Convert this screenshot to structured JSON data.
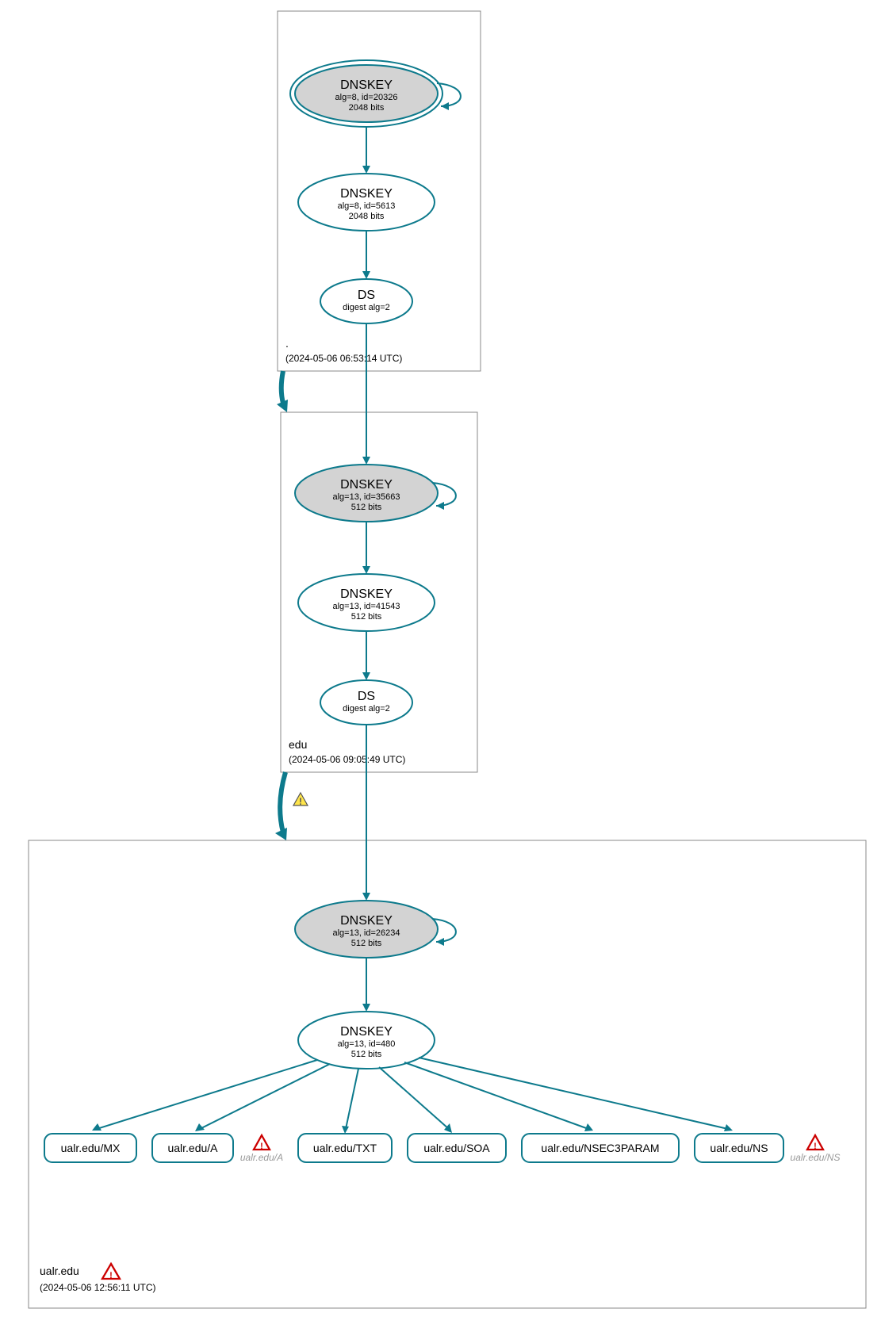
{
  "colors": {
    "teal": "#0d7a8c",
    "grey_fill": "#d3d3d3"
  },
  "zones": {
    "root": {
      "name": ".",
      "timestamp": "(2024-05-06 06:53:14 UTC)",
      "nodes": {
        "ksk": {
          "title": "DNSKEY",
          "sub1": "alg=8, id=20326",
          "sub2": "2048 bits"
        },
        "zsk": {
          "title": "DNSKEY",
          "sub1": "alg=8, id=5613",
          "sub2": "2048 bits"
        },
        "ds": {
          "title": "DS",
          "sub1": "digest alg=2"
        }
      }
    },
    "edu": {
      "name": "edu",
      "timestamp": "(2024-05-06 09:05:49 UTC)",
      "nodes": {
        "ksk": {
          "title": "DNSKEY",
          "sub1": "alg=13, id=35663",
          "sub2": "512 bits"
        },
        "zsk": {
          "title": "DNSKEY",
          "sub1": "alg=13, id=41543",
          "sub2": "512 bits"
        },
        "ds": {
          "title": "DS",
          "sub1": "digest alg=2"
        }
      }
    },
    "ualr": {
      "name": "ualr.edu",
      "timestamp": "(2024-05-06 12:56:11 UTC)",
      "nodes": {
        "ksk": {
          "title": "DNSKEY",
          "sub1": "alg=13, id=26234",
          "sub2": "512 bits"
        },
        "zsk": {
          "title": "DNSKEY",
          "sub1": "alg=13, id=480",
          "sub2": "512 bits"
        }
      },
      "rrsets": [
        "ualr.edu/MX",
        "ualr.edu/A",
        "ualr.edu/TXT",
        "ualr.edu/SOA",
        "ualr.edu/NSEC3PARAM",
        "ualr.edu/NS"
      ],
      "ghosts": [
        "ualr.edu/A",
        "ualr.edu/NS"
      ]
    }
  }
}
